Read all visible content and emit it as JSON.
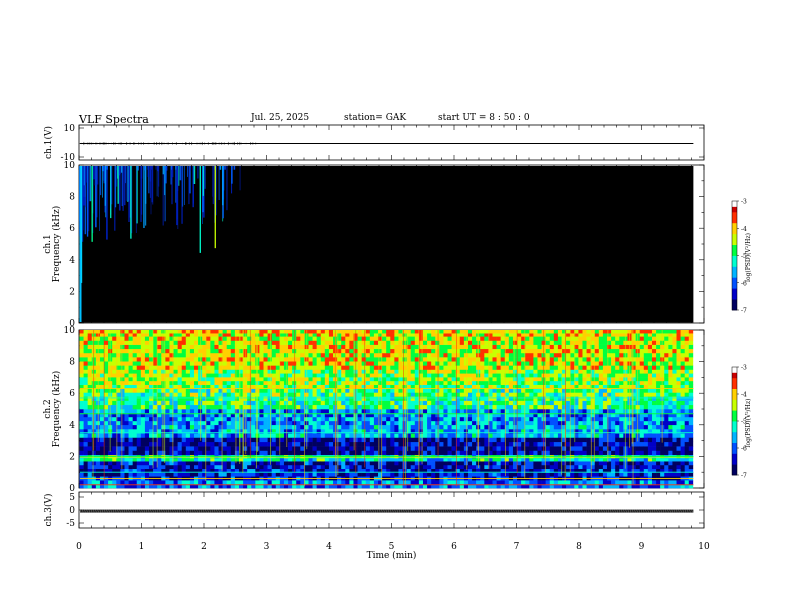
{
  "header": {
    "title": "VLF  Spectra",
    "date": "Jul.  25,  2025",
    "station": "station= GAK",
    "start_ut": "start  UT  =    8  : 50 : 0"
  },
  "chart_data": [
    {
      "type": "line",
      "ylabel": "ch.1(V)",
      "yticks": [
        "10",
        "-10"
      ],
      "ylim": [
        -10,
        10
      ],
      "description_values": {
        "baseline": 0.0
      },
      "xlim": [
        0,
        10
      ]
    },
    {
      "type": "heatmap",
      "ylabel": "ch.1\nFrequency  (kHz)",
      "ylabel_lines": [
        "ch.1",
        "Frequency  (kHz)"
      ],
      "yticks": [
        "0",
        "2",
        "4",
        "6",
        "8",
        "10"
      ],
      "ylim": [
        0,
        10
      ],
      "xlim": [
        0,
        10
      ],
      "background_level": -7,
      "colorbar": {
        "label": "log(PSD)(V²/Hz)",
        "ticks": [
          "-3",
          "-4",
          "-5",
          "-6",
          "-7"
        ]
      }
    },
    {
      "type": "heatmap",
      "ylabel": "ch.2\nFrequency  (kHz)",
      "ylabel_lines": [
        "ch.2",
        "Frequency  (kHz)"
      ],
      "yticks": [
        "0",
        "2",
        "4",
        "6",
        "8",
        "10"
      ],
      "ylim": [
        0,
        10
      ],
      "xlim": [
        0,
        10
      ],
      "colorbar": {
        "label": "log(PSD)(V²/Hz)",
        "ticks": [
          "-3",
          "-4",
          "-5",
          "-6",
          "-7"
        ]
      }
    },
    {
      "type": "line",
      "ylabel": "ch.3(V)",
      "yticks": [
        "5",
        "0",
        "-5"
      ],
      "ylim": [
        -5,
        5
      ],
      "xlim": [
        0,
        10
      ],
      "description_values": {
        "baseline": 0.0
      }
    }
  ],
  "xaxis": {
    "label": "Time  (min)",
    "ticks": [
      "0",
      "1",
      "2",
      "3",
      "4",
      "5",
      "6",
      "7",
      "8",
      "9",
      "10"
    ]
  },
  "colors": {
    "colormap": [
      "#000000",
      "#000060",
      "#0000c8",
      "#0050ff",
      "#00b4ff",
      "#00ffd0",
      "#00ff40",
      "#c8ff00",
      "#ffd000",
      "#ff3000",
      "#c80000",
      "#ffffff"
    ]
  }
}
